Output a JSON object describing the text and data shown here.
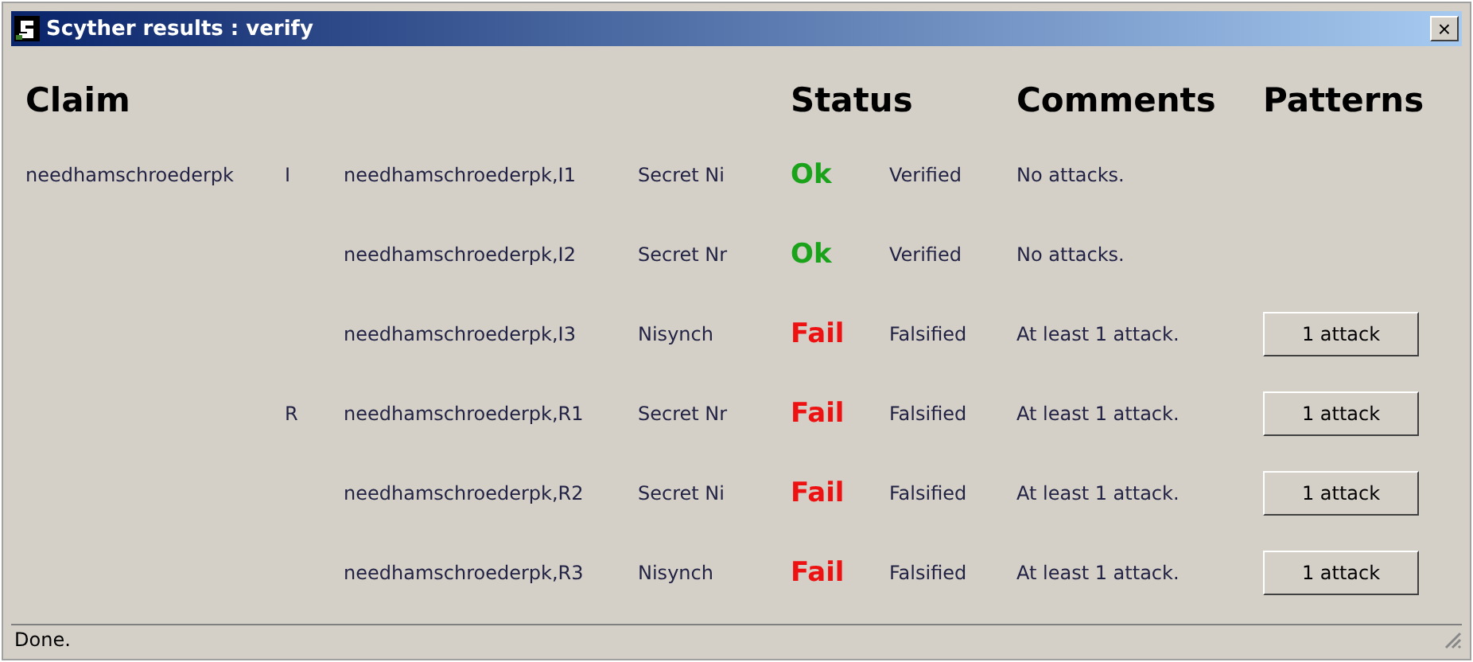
{
  "window": {
    "title": "Scyther results : verify",
    "close": "×"
  },
  "headers": [
    "Claim",
    "Status",
    "Comments",
    "Patterns"
  ],
  "rows": [
    {
      "protocol": "needhamschroederpk",
      "role": "I",
      "claim_id": "needhamschroederpk,I1",
      "claim": "Secret Ni",
      "status": {
        "text": "Ok",
        "kind": "ok"
      },
      "verdict": "Verified",
      "comment": "No attacks."
    },
    {
      "claim_id": "needhamschroederpk,I2",
      "claim": "Secret Nr",
      "status": {
        "text": "Ok",
        "kind": "ok"
      },
      "verdict": "Verified",
      "comment": "No attacks."
    },
    {
      "claim_id": "needhamschroederpk,I3",
      "claim": "Nisynch",
      "status": {
        "text": "Fail",
        "kind": "fail"
      },
      "verdict": "Falsified",
      "comment": "At least 1 attack.",
      "pattern": "1 attack"
    },
    {
      "role": "R",
      "claim_id": "needhamschroederpk,R1",
      "claim": "Secret Nr",
      "status": {
        "text": "Fail",
        "kind": "fail"
      },
      "verdict": "Falsified",
      "comment": "At least 1 attack.",
      "pattern": "1 attack"
    },
    {
      "claim_id": "needhamschroederpk,R2",
      "claim": "Secret Ni",
      "status": {
        "text": "Fail",
        "kind": "fail"
      },
      "verdict": "Falsified",
      "comment": "At least 1 attack.",
      "pattern": "1 attack"
    },
    {
      "claim_id": "needhamschroederpk,R3",
      "claim": "Nisynch",
      "status": {
        "text": "Fail",
        "kind": "fail"
      },
      "verdict": "Falsified",
      "comment": "At least 1 attack.",
      "pattern": "1 attack"
    }
  ],
  "status_bar": "Done."
}
